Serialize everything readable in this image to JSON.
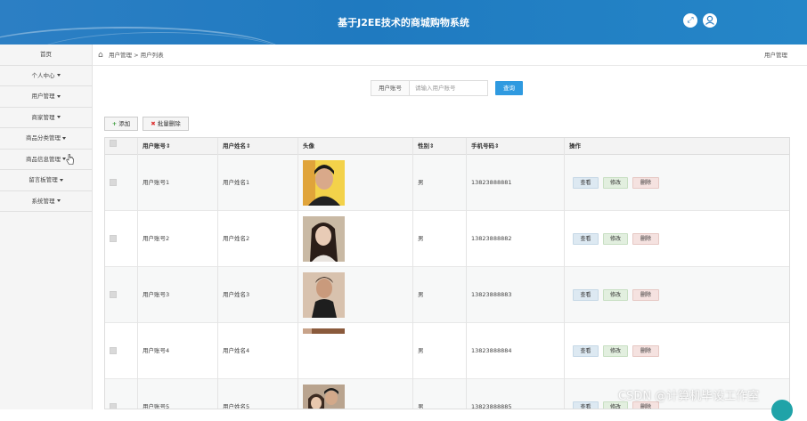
{
  "header": {
    "title": "基于J2EE技术的商城购物系统",
    "icons": [
      "fullscreen-icon",
      "user-icon"
    ]
  },
  "sidebar": {
    "items": [
      {
        "label": "首页",
        "has_caret": false
      },
      {
        "label": "个人中心",
        "has_caret": true
      },
      {
        "label": "用户管理",
        "has_caret": true
      },
      {
        "label": "商家管理",
        "has_caret": true
      },
      {
        "label": "商品分类管理",
        "has_caret": true
      },
      {
        "label": "商品信息管理",
        "has_caret": true
      },
      {
        "label": "留言板管理",
        "has_caret": true
      },
      {
        "label": "系统管理",
        "has_caret": true
      }
    ]
  },
  "breadcrumb": {
    "path": "用户管理 > 用户列表",
    "right": "用户管理"
  },
  "search": {
    "label": "用户账号",
    "placeholder": "请输入用户账号",
    "button": "查询"
  },
  "toolbar": {
    "add": "添加",
    "batch_delete": "批量删除"
  },
  "table": {
    "headers": [
      "用户账号",
      "用户姓名",
      "头像",
      "性别",
      "手机号码",
      "操作"
    ],
    "rows": [
      {
        "account": "用户账号1",
        "name": "用户姓名1",
        "gender": "男",
        "phone": "13823888881"
      },
      {
        "account": "用户账号2",
        "name": "用户姓名2",
        "gender": "男",
        "phone": "13823888882"
      },
      {
        "account": "用户账号3",
        "name": "用户姓名3",
        "gender": "男",
        "phone": "13823888883"
      },
      {
        "account": "用户账号4",
        "name": "用户姓名4",
        "gender": "男",
        "phone": "13823888884"
      },
      {
        "account": "用户账号5",
        "name": "用户姓名5",
        "gender": "男",
        "phone": "13823888885"
      }
    ],
    "actions": {
      "view": "查看",
      "edit": "修改",
      "delete": "删除"
    }
  },
  "watermark": "CSDN @计算机毕设工作室",
  "colors": {
    "header": "#2a7ec3",
    "query_button": "#2f9ae0",
    "accent_green": "#3a9a3a",
    "accent_red": "#d33333"
  }
}
